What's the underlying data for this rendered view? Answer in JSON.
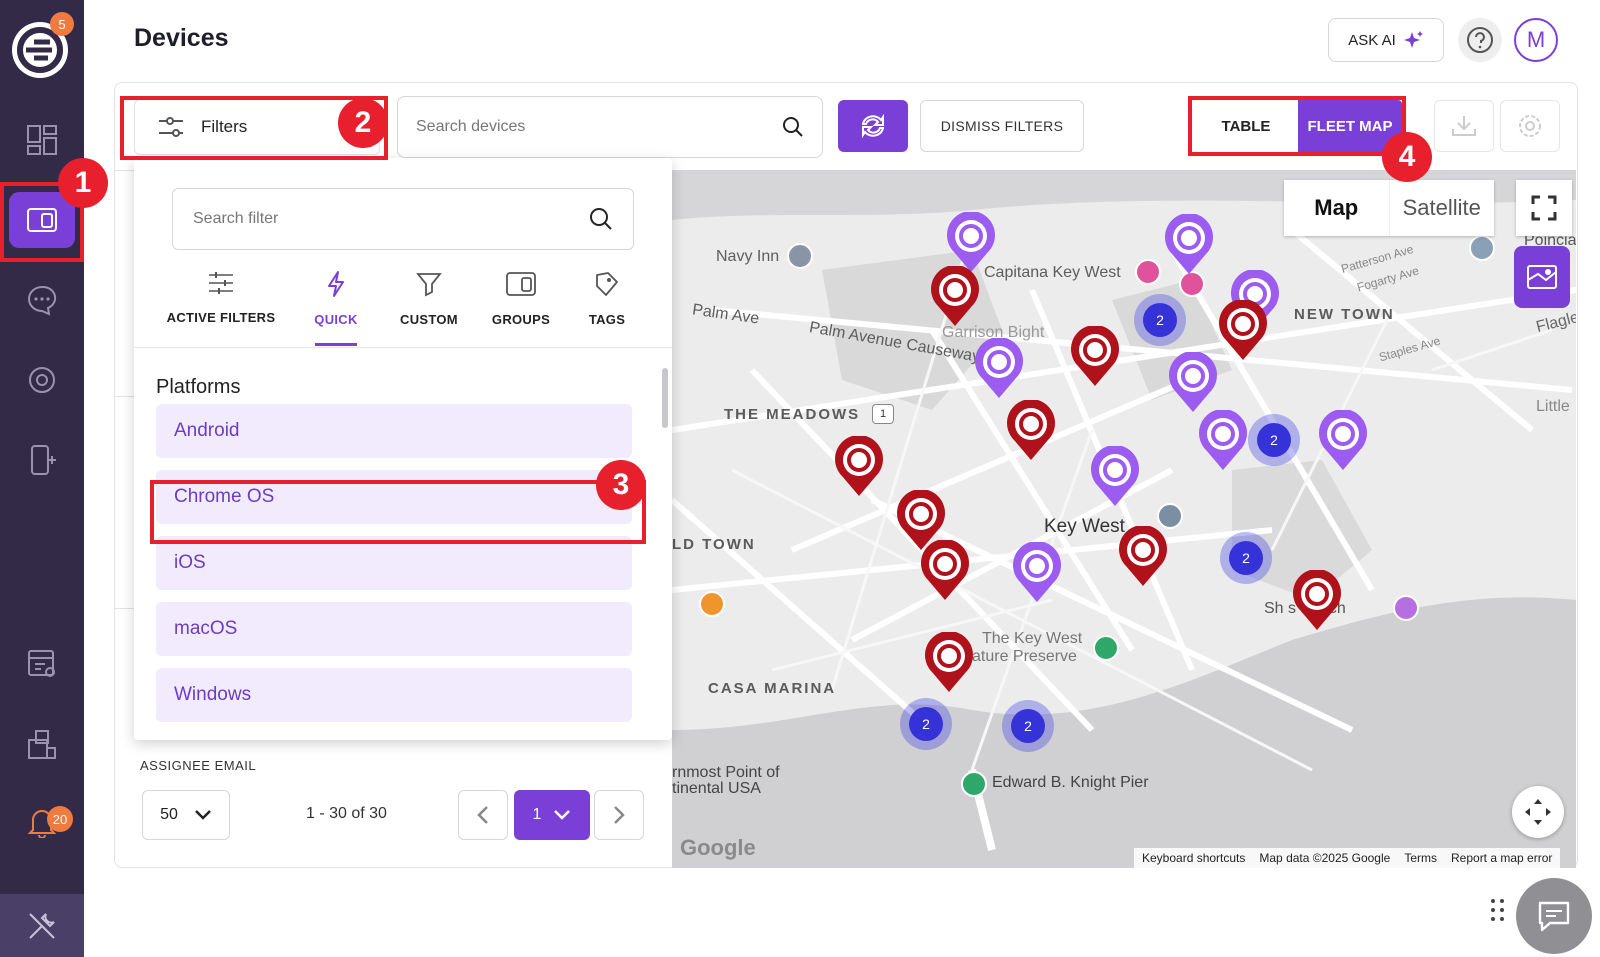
{
  "app": {
    "logo_badge": "5",
    "notification_badge": "20",
    "accent": "#7a3fd6",
    "sidebar_bg": "#322a47"
  },
  "sidebar": {
    "items": [
      {
        "icon": "dashboard-icon"
      },
      {
        "icon": "devices-icon",
        "active": true
      },
      {
        "icon": "messages-icon"
      },
      {
        "icon": "settings-gear-icon"
      },
      {
        "icon": "add-device-icon"
      },
      {
        "icon": "reports-icon"
      },
      {
        "icon": "apps-icon"
      },
      {
        "icon": "bell-icon"
      },
      {
        "icon": "tools-icon"
      }
    ]
  },
  "header": {
    "title": "Devices",
    "ask_ai_label": "ASK AI",
    "avatar_initial": "M"
  },
  "toolbar": {
    "filters_label": "Filters",
    "search_placeholder": "Search devices",
    "dismiss_label": "DISMISS FILTERS",
    "view_table": "TABLE",
    "view_fleet_map": "FLEET MAP",
    "active_view": "FLEET MAP"
  },
  "filter_dropdown": {
    "search_placeholder": "Search filter",
    "tabs": [
      {
        "label": "ACTIVE FILTERS",
        "icon": "sliders-icon"
      },
      {
        "label": "QUICK",
        "icon": "lightning-icon",
        "active": true
      },
      {
        "label": "CUSTOM",
        "icon": "filter-gear-icon"
      },
      {
        "label": "GROUPS",
        "icon": "groups-icon"
      },
      {
        "label": "TAGS",
        "icon": "tag-icon"
      }
    ],
    "section_title": "Platforms",
    "platforms": [
      "Android",
      "Chrome OS",
      "iOS",
      "macOS",
      "Windows"
    ]
  },
  "list": {
    "column_label": "ASSIGNEE EMAIL",
    "per_page": "50",
    "range": "1 - 30 of 30",
    "current_page": "1"
  },
  "map": {
    "type_map": "Map",
    "type_satellite": "Satellite",
    "labels": {
      "navy_inn": "Navy Inn",
      "capitana": "Capitana Key West",
      "palm_ave": "Palm Ave",
      "palm_causeway": "Palm Avenue Causeway",
      "garrison": "Garrison Bight",
      "meadows": "THE MEADOWS",
      "new_town": "NEW TOWN",
      "key_west": "Key West",
      "old_town": "LD TOWN",
      "casa_marina": "CASA MARINA",
      "nature_preserve_1": "The Key West",
      "nature_preserve_2": "ature Preserve",
      "southernmost_1": "rnmost Point of",
      "southernmost_2": "tinental USA",
      "pier": "Edward B. Knight Pier",
      "beach": "Sh        s Beach",
      "little": "Little",
      "flagler": "Flagle",
      "poinciana": "Poincia",
      "patterson": "Patterson Ave",
      "fogarty": "Fogarty Ave",
      "staples": "Staples Ave",
      "route": "1"
    },
    "attribution": [
      "Keyboard shortcuts",
      "Map data ©2025 Google",
      "Terms",
      "Report a map error"
    ],
    "google": "Google",
    "clusters": [
      "2",
      "2",
      "2",
      "2",
      "2"
    ]
  },
  "annotations": [
    "1",
    "2",
    "3",
    "4"
  ]
}
